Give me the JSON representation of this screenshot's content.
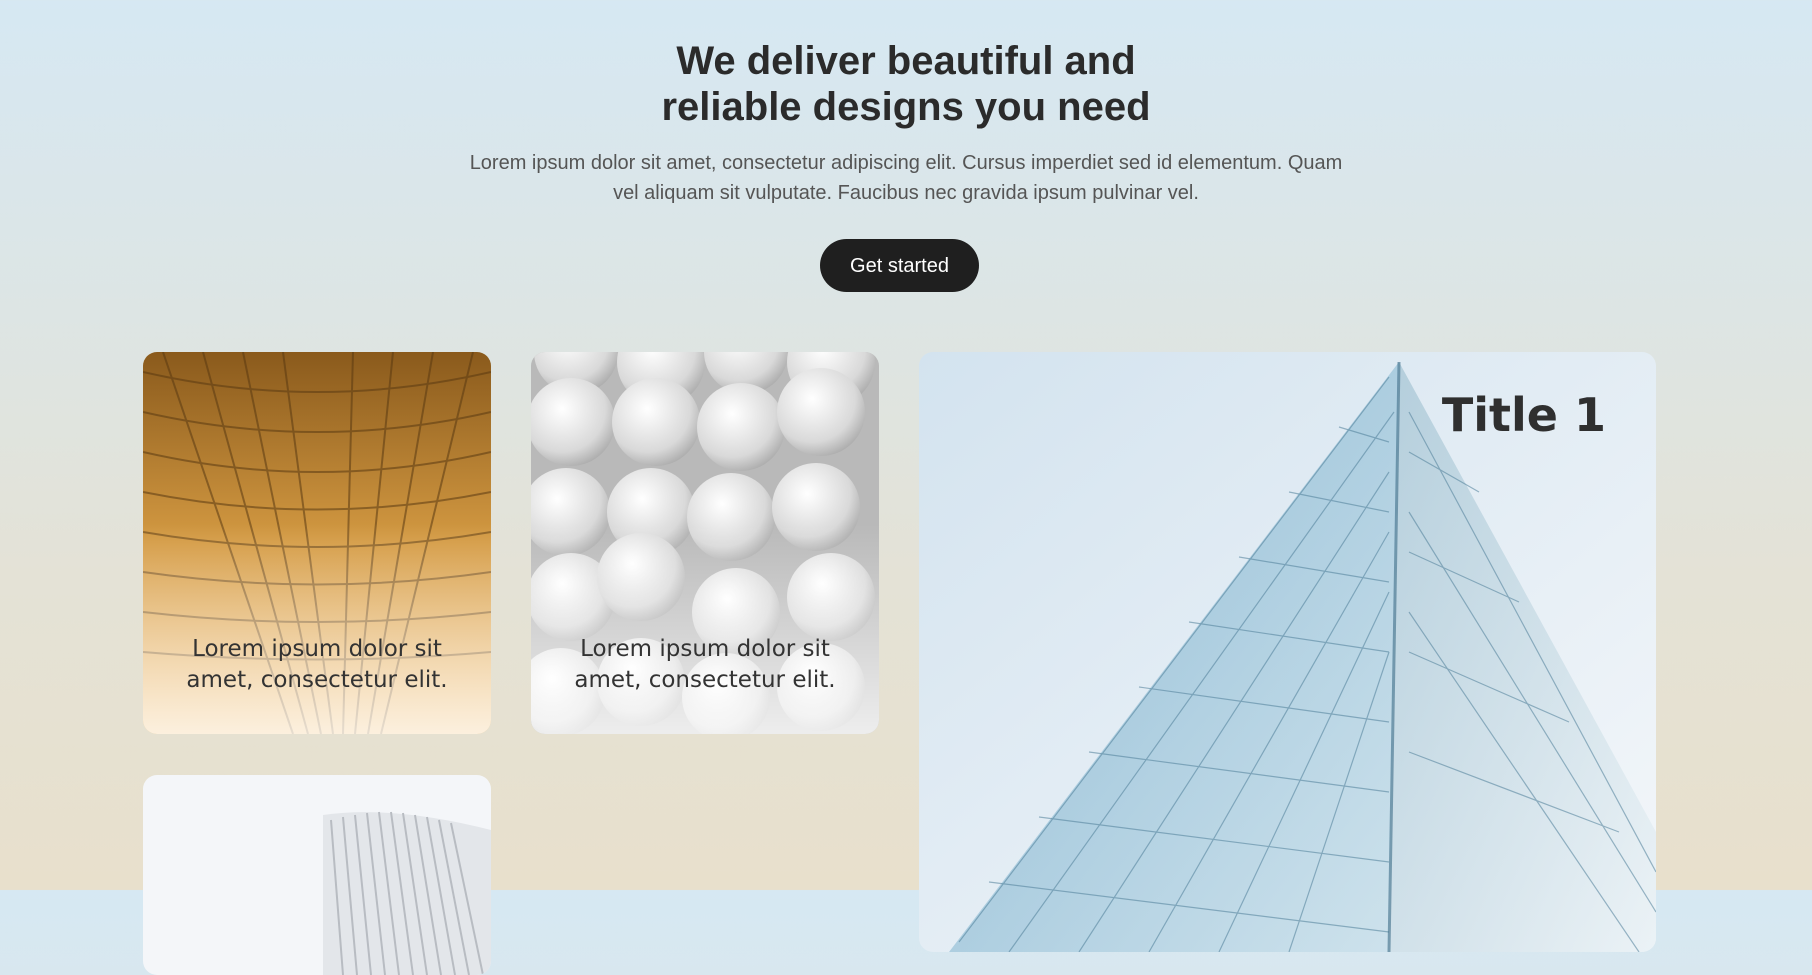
{
  "hero": {
    "title_line1": "We deliver beautiful and",
    "title_line2": "reliable designs you need",
    "subtitle": "Lorem ipsum dolor sit amet, consectetur adipiscing elit. Cursus imperdiet sed id elementum. Quam vel aliquam sit vulputate. Faucibus nec gravida ipsum pulvinar vel.",
    "cta_label": "Get started"
  },
  "cards": [
    {
      "caption_line1": "Lorem ipsum dolor sit",
      "caption_line2": "amet, consectetur elit.",
      "image": "golden-atrium-architecture"
    },
    {
      "caption_line1": "Lorem ipsum dolor sit",
      "caption_line2": "amet, consectetur elit.",
      "image": "white-spheres-pattern"
    },
    {
      "image": "white-curved-building"
    },
    {
      "title": "Title 1",
      "image": "glass-skyscraper"
    }
  ],
  "colors": {
    "button_bg": "#1f1f1f",
    "title_text": "#2b2b2b",
    "body_text": "#555555"
  }
}
